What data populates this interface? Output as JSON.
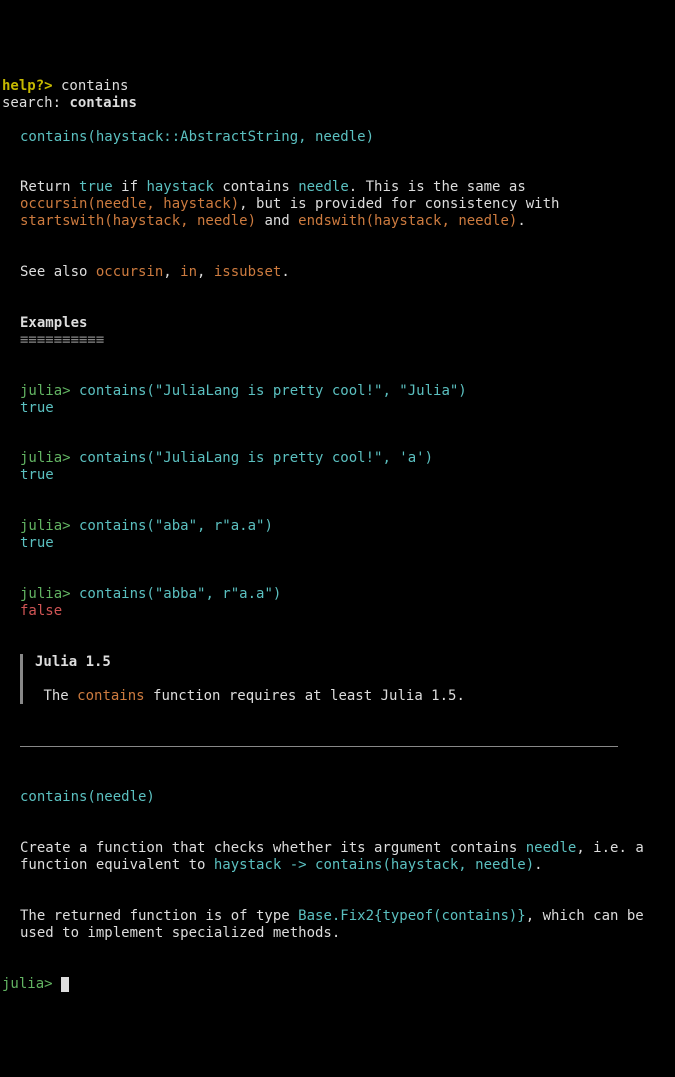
{
  "prompt": {
    "help_label": "help?>",
    "query": " contains",
    "search_label": "search: ",
    "search_result": "contains"
  },
  "sig1": "contains(haystack::AbstractString, needle)",
  "desc1": {
    "t1": "Return ",
    "k_true": "true",
    "t2": " if ",
    "k_haystack": "haystack",
    "t3": " contains ",
    "k_needle": "needle",
    "t4": ". This is the same as",
    "occursin": "occursin(needle, haystack)",
    "t5": ", but is provided for consistency with",
    "startswith": "startswith(haystack, needle)",
    "t6": " and ",
    "endswith": "endswith(haystack, needle)",
    "t7": "."
  },
  "seealso": {
    "t1": "See also ",
    "occursin": "occursin",
    "t2": ", ",
    "in": "in",
    "t3": ", ",
    "issubset": "issubset",
    "t4": "."
  },
  "examples_heading": "Examples",
  "examples_underline": "≡≡≡≡≡≡≡≡≡≡",
  "ex": [
    {
      "prompt": "julia>",
      "code": " contains(\"JuliaLang is pretty cool!\", \"Julia\")",
      "out": "true",
      "out_cls": "cyan"
    },
    {
      "prompt": "julia>",
      "code": " contains(\"JuliaLang is pretty cool!\", 'a')",
      "out": "true",
      "out_cls": "cyan"
    },
    {
      "prompt": "julia>",
      "code": " contains(\"aba\", r\"a.a\")",
      "out": "true",
      "out_cls": "cyan"
    },
    {
      "prompt": "julia>",
      "code": " contains(\"abba\", r\"a.a\")",
      "out": "false",
      "out_cls": "red"
    }
  ],
  "compat": {
    "title": "Julia 1.5",
    "t1": "The ",
    "k_contains": "contains",
    "t2": " function requires at least Julia 1.5."
  },
  "sig2": "contains(needle)",
  "desc2": {
    "t1": "Create a function that checks whether its argument contains ",
    "k_needle": "needle",
    "t2": ", i.e. a",
    "t3": "function equivalent to ",
    "lambda": "haystack -> contains(haystack, needle)",
    "t4": "."
  },
  "desc3": {
    "t1": "The returned function is of type ",
    "fix2": "Base.Fix2{typeof(contains)}",
    "t2": ", which can be",
    "t3": "used to implement specialized methods."
  },
  "final_prompt": "julia>"
}
